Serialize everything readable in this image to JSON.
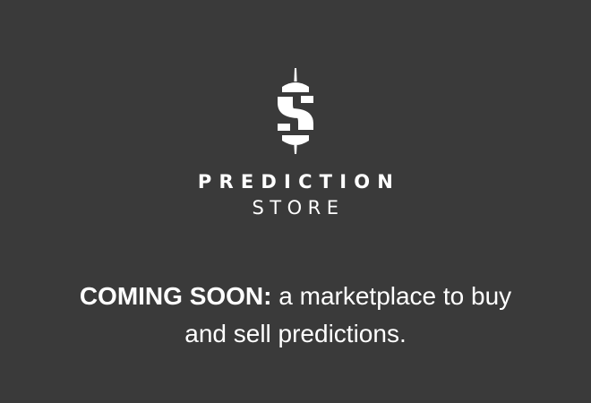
{
  "colors": {
    "background": "#3a3a3a",
    "foreground": "#ffffff"
  },
  "logo": {
    "icon": "dollar-sign-icon",
    "line1": "PREDICTION",
    "line2": "STORE"
  },
  "announcement": {
    "highlight": "COMING SOON:",
    "line1_rest": "a marketplace to buy",
    "line2": "and sell predictions."
  }
}
